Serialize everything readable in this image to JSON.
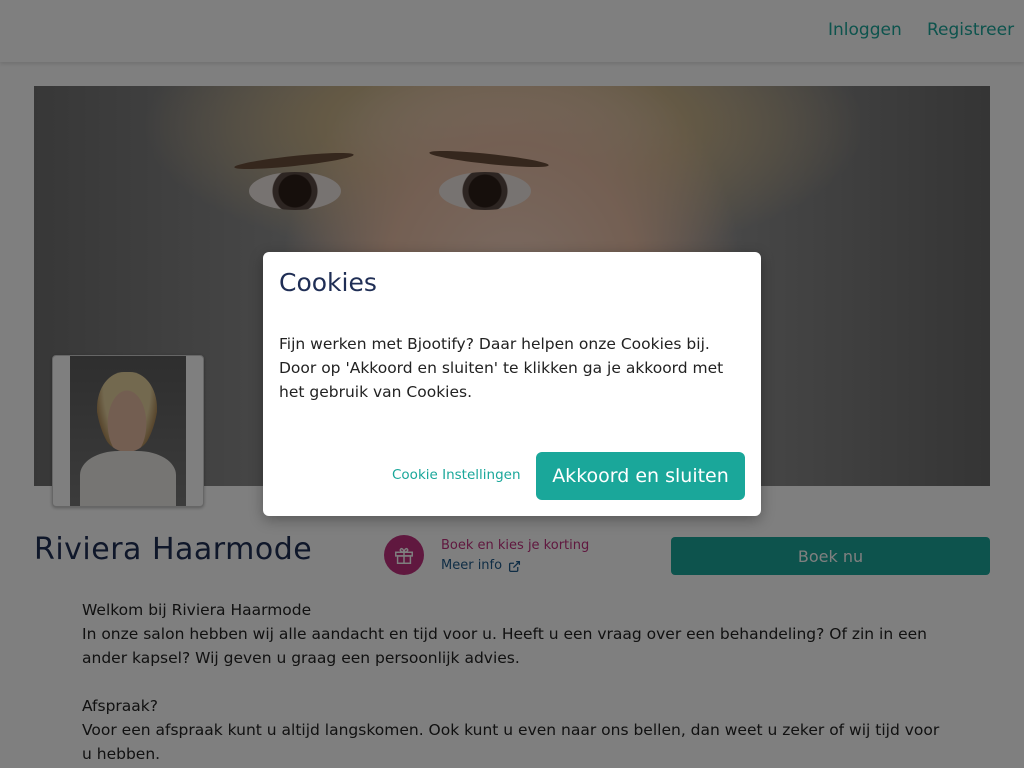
{
  "nav": {
    "login": "Inloggen",
    "register": "Registreer"
  },
  "salon": {
    "name": "Riviera Haarmode",
    "promo_line": "Boek en kies je korting",
    "more_info": "Meer info",
    "book_button": "Boek nu"
  },
  "content": {
    "welcome": "Welkom bij Riviera Haarmode",
    "intro": "In onze salon hebben wij alle aandacht en tijd voor u. Heeft u een vraag over een behandeling? Of zin in een ander kapsel? Wij geven u graag een persoonlijk advies.",
    "appointment_heading": "Afspraak?",
    "appointment_text": "Voor een afspraak kunt u altijd langskomen. Ook kunt u even naar ons bellen, dan weet u zeker of wij tijd voor u hebben."
  },
  "cookie_modal": {
    "title": "Cookies",
    "body": "Fijn werken met Bjootify? Daar helpen onze Cookies bij. Door op 'Akkoord en sluiten' te klikken ga je akkoord met het gebruik van Cookies.",
    "settings_label": "Cookie Instellingen",
    "accept_label": "Akkoord en sluiten"
  },
  "colors": {
    "accent": "#1aa79a",
    "promo": "#c0307f",
    "heading": "#1f2e55"
  },
  "icons": {
    "promo": "gift-icon",
    "external": "external-link-icon"
  }
}
